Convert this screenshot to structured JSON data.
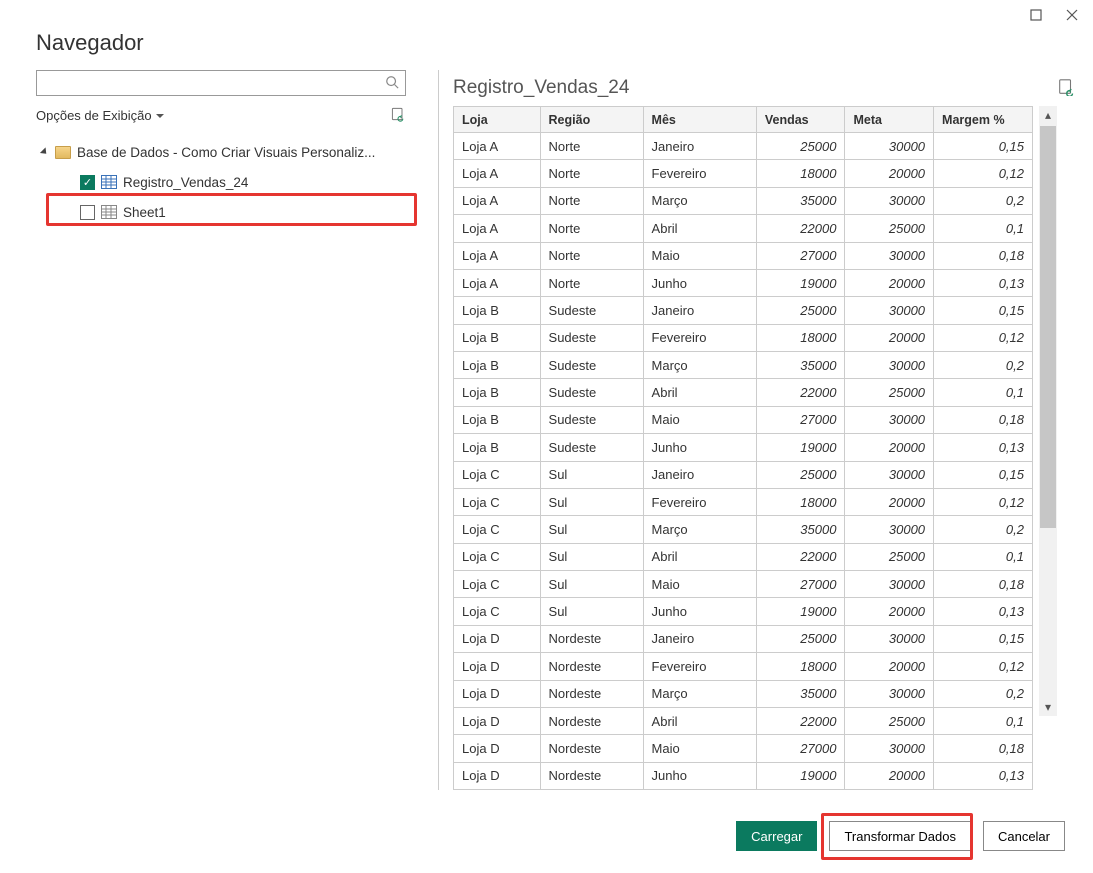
{
  "titles": {
    "dialog": "Navegador",
    "preview": "Registro_Vendas_24"
  },
  "leftPanel": {
    "searchPlaceholder": "",
    "displayOptions": "Opções de Exibição",
    "rootLabel": "Base de Dados - Como Criar Visuais Personaliz...",
    "item1": "Registro_Vendas_24",
    "item2": "Sheet1"
  },
  "footer": {
    "load": "Carregar",
    "transform": "Transformar Dados",
    "cancel": "Cancelar"
  },
  "table": {
    "headers": {
      "loja": "Loja",
      "regiao": "Região",
      "mes": "Mês",
      "vendas": "Vendas",
      "meta": "Meta",
      "margem": "Margem %"
    },
    "rows": [
      {
        "loja": "Loja A",
        "regiao": "Norte",
        "mes": "Janeiro",
        "vendas": "25000",
        "meta": "30000",
        "margem": "0,15"
      },
      {
        "loja": "Loja A",
        "regiao": "Norte",
        "mes": "Fevereiro",
        "vendas": "18000",
        "meta": "20000",
        "margem": "0,12"
      },
      {
        "loja": "Loja A",
        "regiao": "Norte",
        "mes": "Março",
        "vendas": "35000",
        "meta": "30000",
        "margem": "0,2"
      },
      {
        "loja": "Loja A",
        "regiao": "Norte",
        "mes": "Abril",
        "vendas": "22000",
        "meta": "25000",
        "margem": "0,1"
      },
      {
        "loja": "Loja A",
        "regiao": "Norte",
        "mes": "Maio",
        "vendas": "27000",
        "meta": "30000",
        "margem": "0,18"
      },
      {
        "loja": "Loja A",
        "regiao": "Norte",
        "mes": "Junho",
        "vendas": "19000",
        "meta": "20000",
        "margem": "0,13"
      },
      {
        "loja": "Loja B",
        "regiao": "Sudeste",
        "mes": "Janeiro",
        "vendas": "25000",
        "meta": "30000",
        "margem": "0,15"
      },
      {
        "loja": "Loja B",
        "regiao": "Sudeste",
        "mes": "Fevereiro",
        "vendas": "18000",
        "meta": "20000",
        "margem": "0,12"
      },
      {
        "loja": "Loja B",
        "regiao": "Sudeste",
        "mes": "Março",
        "vendas": "35000",
        "meta": "30000",
        "margem": "0,2"
      },
      {
        "loja": "Loja B",
        "regiao": "Sudeste",
        "mes": "Abril",
        "vendas": "22000",
        "meta": "25000",
        "margem": "0,1"
      },
      {
        "loja": "Loja B",
        "regiao": "Sudeste",
        "mes": "Maio",
        "vendas": "27000",
        "meta": "30000",
        "margem": "0,18"
      },
      {
        "loja": "Loja B",
        "regiao": "Sudeste",
        "mes": "Junho",
        "vendas": "19000",
        "meta": "20000",
        "margem": "0,13"
      },
      {
        "loja": "Loja C",
        "regiao": "Sul",
        "mes": "Janeiro",
        "vendas": "25000",
        "meta": "30000",
        "margem": "0,15"
      },
      {
        "loja": "Loja C",
        "regiao": "Sul",
        "mes": "Fevereiro",
        "vendas": "18000",
        "meta": "20000",
        "margem": "0,12"
      },
      {
        "loja": "Loja C",
        "regiao": "Sul",
        "mes": "Março",
        "vendas": "35000",
        "meta": "30000",
        "margem": "0,2"
      },
      {
        "loja": "Loja C",
        "regiao": "Sul",
        "mes": "Abril",
        "vendas": "22000",
        "meta": "25000",
        "margem": "0,1"
      },
      {
        "loja": "Loja C",
        "regiao": "Sul",
        "mes": "Maio",
        "vendas": "27000",
        "meta": "30000",
        "margem": "0,18"
      },
      {
        "loja": "Loja C",
        "regiao": "Sul",
        "mes": "Junho",
        "vendas": "19000",
        "meta": "20000",
        "margem": "0,13"
      },
      {
        "loja": "Loja D",
        "regiao": "Nordeste",
        "mes": "Janeiro",
        "vendas": "25000",
        "meta": "30000",
        "margem": "0,15"
      },
      {
        "loja": "Loja D",
        "regiao": "Nordeste",
        "mes": "Fevereiro",
        "vendas": "18000",
        "meta": "20000",
        "margem": "0,12"
      },
      {
        "loja": "Loja D",
        "regiao": "Nordeste",
        "mes": "Março",
        "vendas": "35000",
        "meta": "30000",
        "margem": "0,2"
      },
      {
        "loja": "Loja D",
        "regiao": "Nordeste",
        "mes": "Abril",
        "vendas": "22000",
        "meta": "25000",
        "margem": "0,1"
      },
      {
        "loja": "Loja D",
        "regiao": "Nordeste",
        "mes": "Maio",
        "vendas": "27000",
        "meta": "30000",
        "margem": "0,18"
      },
      {
        "loja": "Loja D",
        "regiao": "Nordeste",
        "mes": "Junho",
        "vendas": "19000",
        "meta": "20000",
        "margem": "0,13"
      }
    ]
  }
}
